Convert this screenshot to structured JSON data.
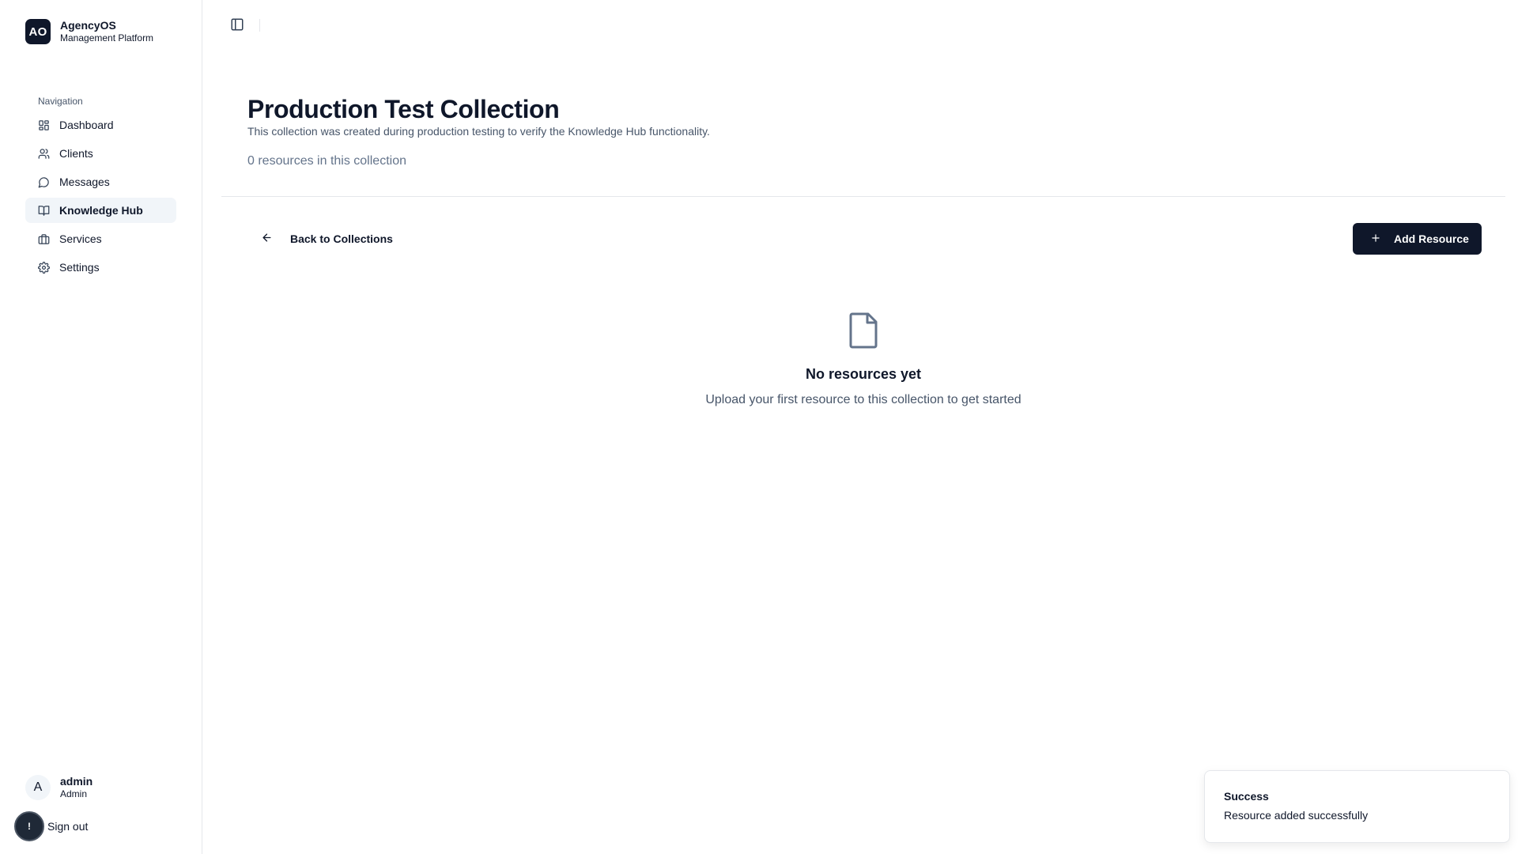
{
  "brand": {
    "logo_text": "AO",
    "name": "AgencyOS",
    "subtitle": "Management Platform"
  },
  "sidebar": {
    "section_label": "Navigation",
    "items": [
      {
        "label": "Dashboard",
        "icon": "dashboard-icon",
        "active": false
      },
      {
        "label": "Clients",
        "icon": "users-icon",
        "active": false
      },
      {
        "label": "Messages",
        "icon": "message-icon",
        "active": false
      },
      {
        "label": "Knowledge Hub",
        "icon": "book-icon",
        "active": true
      },
      {
        "label": "Services",
        "icon": "briefcase-icon",
        "active": false
      },
      {
        "label": "Settings",
        "icon": "gear-icon",
        "active": false
      }
    ]
  },
  "user": {
    "avatar_initial": "A",
    "name": "admin",
    "role": "Admin",
    "sign_out_label": "Sign out",
    "sign_out_badge": "!"
  },
  "topbar": {
    "toggle_icon": "sidebar-toggle-icon"
  },
  "collection": {
    "title": "Production Test Collection",
    "description": "This collection was created during production testing to verify the Knowledge Hub functionality.",
    "resource_count": "0 resources in this collection"
  },
  "actions": {
    "back_label": "Back to Collections",
    "add_label": "Add Resource"
  },
  "empty_state": {
    "icon": "file-icon",
    "title": "No resources yet",
    "subtitle": "Upload your first resource to this collection to get started"
  },
  "toast": {
    "title": "Success",
    "message": "Resource added successfully"
  },
  "colors": {
    "primary": "#0f172a",
    "muted": "#64748b",
    "active_bg": "#f1f5f9",
    "border": "#e5e7eb"
  }
}
